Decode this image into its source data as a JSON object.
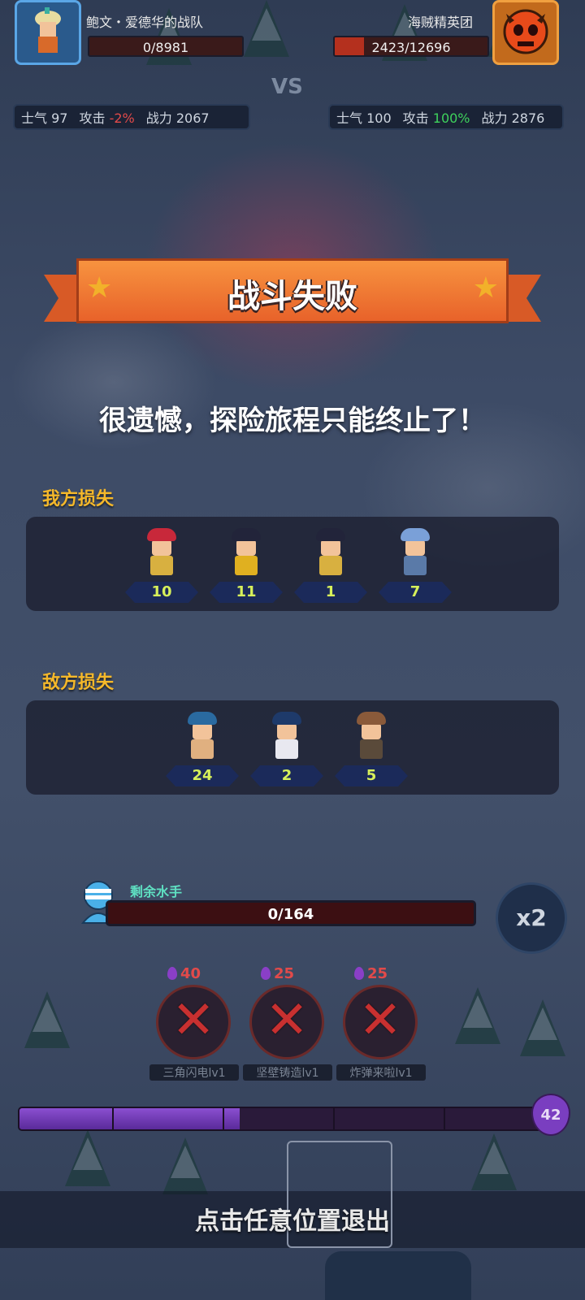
{
  "left_team": {
    "name": "鲍文・爱德华的战队",
    "hp_text": "0/8981",
    "hp_fraction": 0.0,
    "morale_label": "士气",
    "morale_value": "97",
    "attack_label": "攻击",
    "attack_value": "-2%",
    "power_label": "战力",
    "power_value": "2067",
    "avatar_color": "#2a5a8c"
  },
  "vs_label": "VS",
  "right_team": {
    "name": "海贼精英团",
    "hp_text": "2423/12696",
    "hp_fraction": 0.19,
    "morale_label": "士气",
    "morale_value": "100",
    "attack_label": "攻击",
    "attack_value": "100%",
    "power_label": "战力",
    "power_value": "2876",
    "avatar_color": "#c26a1c"
  },
  "banner": {
    "title": "战斗失败"
  },
  "subtitle": "很遗憾，探险旅程只能终止了！",
  "our_losses": {
    "label": "我方损失",
    "units": [
      {
        "icon": "pirate-captain-icon",
        "count": "10",
        "hat": "#c8283a",
        "body": "#d8b040"
      },
      {
        "icon": "shield-soldier-icon",
        "count": "11",
        "hat": "#22243a",
        "body": "#e0b020"
      },
      {
        "icon": "musketeer-icon",
        "count": "1",
        "hat": "#22243a",
        "body": "#d8b040"
      },
      {
        "icon": "bearded-sailor-icon",
        "count": "7",
        "hat": "#7aa0d8",
        "body": "#5a7aa8"
      }
    ]
  },
  "enemy_losses": {
    "label": "敌方损失",
    "units": [
      {
        "icon": "brute-pirate-icon",
        "count": "24",
        "hat": "#2a6aa0",
        "body": "#e0b080"
      },
      {
        "icon": "spear-pirate-icon",
        "count": "2",
        "hat": "#1e3a6a",
        "body": "#e8e8f0"
      },
      {
        "icon": "skull-hat-pirate-icon",
        "count": "5",
        "hat": "#8a5a3a",
        "body": "#5a4a3a"
      }
    ]
  },
  "sailors": {
    "label": "剩余水手",
    "value_text": "0/164"
  },
  "speed_button": "x2",
  "skills": [
    {
      "cost": "40",
      "name": "三角闪电lv1"
    },
    {
      "cost": "25",
      "name": "坚壁铸造lv1"
    },
    {
      "cost": "25",
      "name": "炸弹来啦lv1"
    }
  ],
  "energy": {
    "value": "42",
    "fill_fraction": 0.42
  },
  "exit_prompt": "点击任意位置退出"
}
